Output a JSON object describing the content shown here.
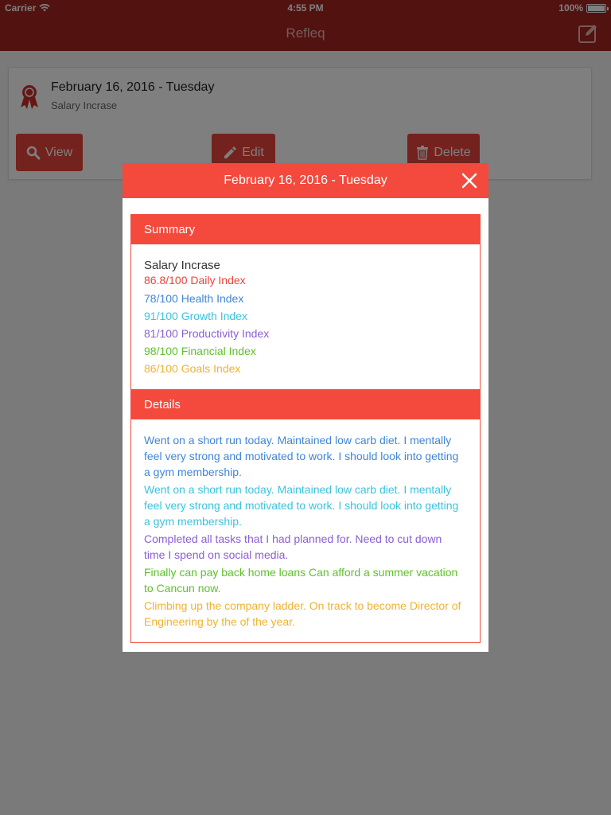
{
  "status_bar": {
    "carrier": "Carrier",
    "time": "4:55 PM",
    "battery": "100%"
  },
  "nav": {
    "title": "Refleq",
    "compose_icon": "compose-icon"
  },
  "entry_card": {
    "date": "February 16, 2016 - Tuesday",
    "subtitle": "Salary Incrase",
    "buttons": {
      "view": "View",
      "edit": "Edit",
      "delete": "Delete"
    }
  },
  "modal": {
    "title": "February 16, 2016 - Tuesday",
    "summary": {
      "heading": "Summary",
      "entry_title": "Salary Incrase",
      "indexes": [
        {
          "text": "86.8/100 Daily Index",
          "color": "#e8453c"
        },
        {
          "text": "78/100 Health Index",
          "color": "#3f86d9"
        },
        {
          "text": "91/100 Growth Index",
          "color": "#3cc3dc"
        },
        {
          "text": "81/100 Productivity Index",
          "color": "#8a5fd6"
        },
        {
          "text": "98/100 Financial Index",
          "color": "#5fc12b"
        },
        {
          "text": "86/100 Goals Index",
          "color": "#efb331"
        }
      ]
    },
    "details": {
      "heading": "Details",
      "notes": [
        {
          "text": "Went on a short run today. Maintained low carb diet. I mentally feel very strong and motivated to work. I should look into getting a gym membership.",
          "color": "#3f86d9"
        },
        {
          "text": "Went on a short run today. Maintained low carb diet. I mentally feel very strong and motivated to work. I should look into getting a gym membership.",
          "color": "#3cc3dc"
        },
        {
          "text": "Completed all tasks that I had planned for. Need to cut down time I spend on social media.",
          "color": "#8a5fd6"
        },
        {
          "text": "Finally can pay back home loans Can afford a summer vacation to Cancun now.",
          "color": "#5fc12b"
        },
        {
          "text": "Climbing up the company ladder. On track to become Director of Engineering by the of the year.",
          "color": "#efb331"
        }
      ]
    }
  },
  "colors": {
    "nav_red": "#a52420",
    "accent_red": "#f34a3d",
    "button_red": "#e8453c"
  }
}
